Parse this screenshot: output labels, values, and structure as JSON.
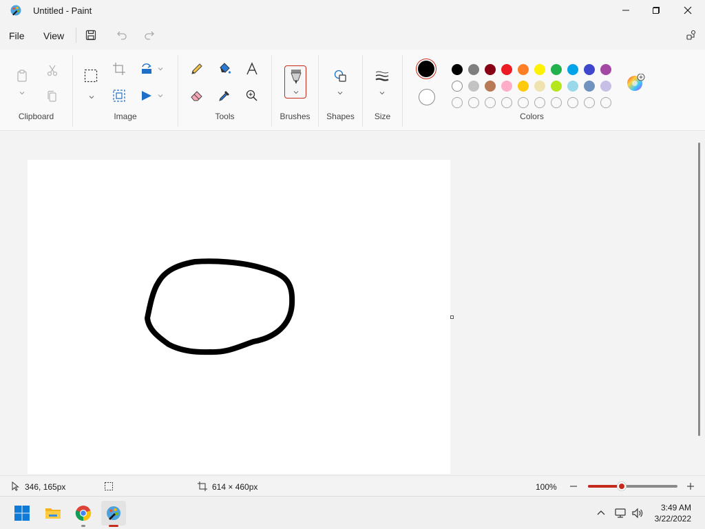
{
  "window": {
    "title": "Untitled - Paint"
  },
  "menu": {
    "file": "File",
    "view": "View"
  },
  "ribbon": {
    "groups": {
      "clipboard": "Clipboard",
      "image": "Image",
      "tools": "Tools",
      "brushes": "Brushes",
      "shapes": "Shapes",
      "size": "Size",
      "colors": "Colors"
    }
  },
  "colors": {
    "primary": "#000000",
    "secondary": "#ffffff",
    "accent": "#c42b1c",
    "palette_row1": [
      "#000000",
      "#7f7f7f",
      "#880015",
      "#ed1c24",
      "#ff7f27",
      "#fff200",
      "#22b14c",
      "#00a2e8",
      "#3f48cc",
      "#a349a4"
    ],
    "palette_row2": [
      "#ffffff",
      "#c3c3c3",
      "#b97a57",
      "#ffaec9",
      "#ffc90e",
      "#efe4b0",
      "#b5e61d",
      "#99d9ea",
      "#7092be",
      "#c8bfe7"
    ],
    "palette_row3_count_empty": 10
  },
  "status": {
    "cursor_position": "346, 165px",
    "canvas_size": "614 × 460px",
    "zoom": "100%",
    "zoom_slider_fraction": 0.38
  },
  "taskbar": {
    "time": "3:49 AM",
    "date": "3/22/2022"
  },
  "icons": {
    "app": "paint-icon",
    "minimize": "minimize-icon",
    "maximize": "maximize-icon",
    "close": "close-icon",
    "save": "save-icon",
    "undo": "undo-icon",
    "redo": "redo-icon",
    "share": "share-icon"
  }
}
